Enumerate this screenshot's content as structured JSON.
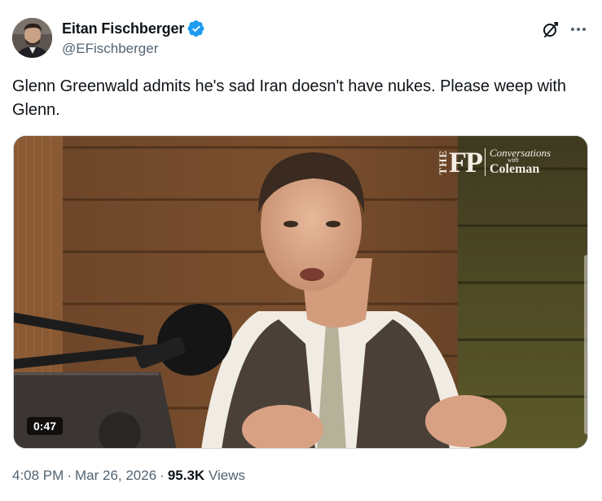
{
  "author": {
    "display_name": "Eitan Fischberger",
    "handle": "@EFischberger",
    "verified_color": "#1d9bf0",
    "avatar_icon": "profile-photo"
  },
  "header_actions": {
    "grok_icon": "grok-icon",
    "more_icon": "more-dots-icon"
  },
  "tweet": {
    "text": "Glenn Greenwald admits he's sad Iran doesn't have nukes. Please weep with Glenn."
  },
  "media": {
    "type": "video",
    "duration": "0:47",
    "watermark": {
      "the": "THE",
      "fp": "FP",
      "line1": "Conversations",
      "line2": "with",
      "line3": "Coleman"
    }
  },
  "meta": {
    "time": "4:08 PM",
    "date": "Mar 26, 2026",
    "views_count": "95.3K",
    "views_label": "Views",
    "separator": "·"
  },
  "colors": {
    "text_primary": "#0f1419",
    "text_secondary": "#536471",
    "verified_blue": "#1d9bf0"
  }
}
